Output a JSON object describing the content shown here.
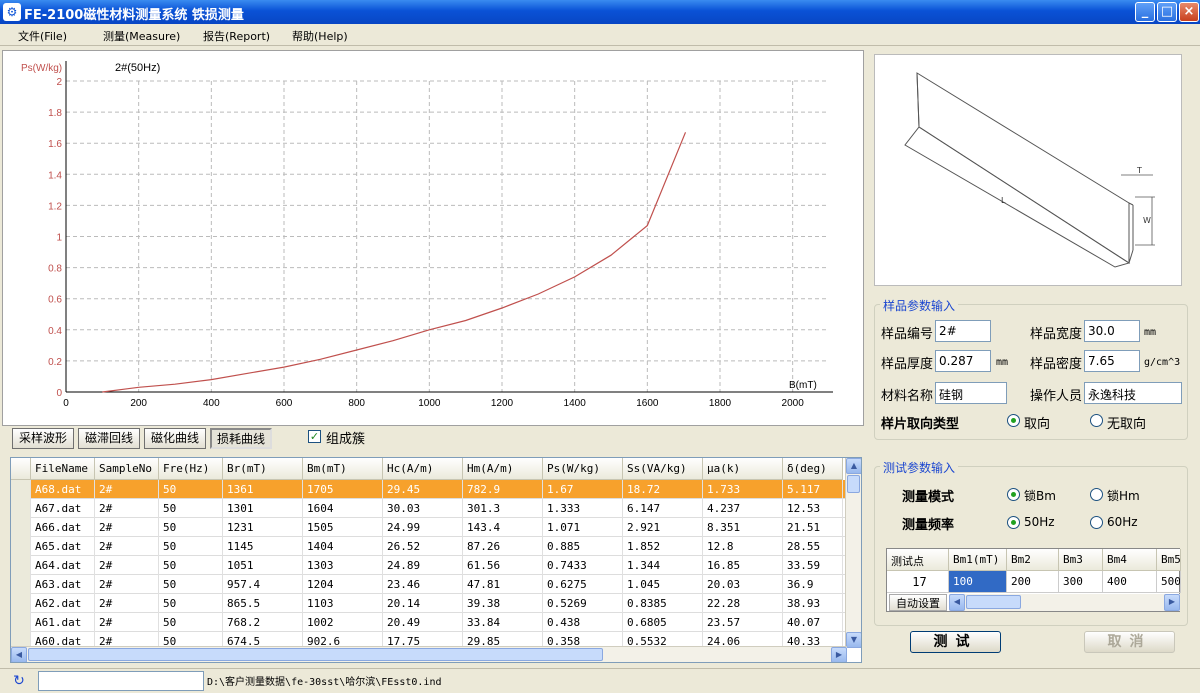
{
  "window": {
    "title": "FE-2100磁性材料测量系统  铁损测量",
    "min": "_",
    "max": "□",
    "close": "×"
  },
  "menu": [
    "文件(File)",
    "测量(Measure)",
    "报告(Report)",
    "帮助(Help)"
  ],
  "chart_data": {
    "type": "line",
    "title": "2#(50Hz)",
    "ylabel": "Ps(W/kg)",
    "xlabel": "B(mT)",
    "xlim": [
      0,
      2100
    ],
    "ylim": [
      0,
      2
    ],
    "xticks": [
      0,
      200,
      400,
      600,
      800,
      1000,
      1200,
      1400,
      1600,
      1800,
      2000
    ],
    "yticks": [
      0,
      0.2,
      0.4,
      0.6,
      0.8,
      1,
      1.2,
      1.4,
      1.6,
      1.8,
      2
    ],
    "grid": true,
    "line_color": "#c0504d",
    "x": [
      100,
      200,
      300,
      400,
      500,
      600,
      700,
      800,
      900,
      1000,
      1100,
      1200,
      1300,
      1400,
      1500,
      1600,
      1705
    ],
    "y": [
      0.0,
      0.03,
      0.05,
      0.08,
      0.12,
      0.16,
      0.21,
      0.27,
      0.33,
      0.4,
      0.46,
      0.54,
      0.63,
      0.74,
      0.88,
      1.07,
      1.67
    ]
  },
  "tabs": [
    "采样波形",
    "磁滞回线",
    "磁化曲线",
    "损耗曲线"
  ],
  "group_checkbox": {
    "label": "组成簇",
    "check": "✓"
  },
  "table": {
    "columns": [
      "FileName",
      "SampleNo",
      "Fre(Hz)",
      "Br(mT)",
      "Bm(mT)",
      "Hc(A/m)",
      "Hm(A/m)",
      "Ps(W/kg)",
      "Ss(VA/kg)",
      "μa(k)",
      "δ(deg)"
    ],
    "rows": [
      [
        "A68.dat",
        "2#",
        "50",
        "1361",
        "1705",
        "29.45",
        "782.9",
        "1.67",
        "18.72",
        "1.733",
        "5.117"
      ],
      [
        "A67.dat",
        "2#",
        "50",
        "1301",
        "1604",
        "30.03",
        "301.3",
        "1.333",
        "6.147",
        "4.237",
        "12.53"
      ],
      [
        "A66.dat",
        "2#",
        "50",
        "1231",
        "1505",
        "24.99",
        "143.4",
        "1.071",
        "2.921",
        "8.351",
        "21.51"
      ],
      [
        "A65.dat",
        "2#",
        "50",
        "1145",
        "1404",
        "26.52",
        "87.26",
        "0.885",
        "1.852",
        "12.8",
        "28.55"
      ],
      [
        "A64.dat",
        "2#",
        "50",
        "1051",
        "1303",
        "24.89",
        "61.56",
        "0.7433",
        "1.344",
        "16.85",
        "33.59"
      ],
      [
        "A63.dat",
        "2#",
        "50",
        "957.4",
        "1204",
        "23.46",
        "47.81",
        "0.6275",
        "1.045",
        "20.03",
        "36.9"
      ],
      [
        "A62.dat",
        "2#",
        "50",
        "865.5",
        "1103",
        "20.14",
        "39.38",
        "0.5269",
        "0.8385",
        "22.28",
        "38.93"
      ],
      [
        "A61.dat",
        "2#",
        "50",
        "768.2",
        "1002",
        "20.49",
        "33.84",
        "0.438",
        "0.6805",
        "23.57",
        "40.07"
      ],
      [
        "A60.dat",
        "2#",
        "50",
        "674.5",
        "902.6",
        "17.75",
        "29.85",
        "0.358",
        "0.5532",
        "24.06",
        "40.33"
      ]
    ]
  },
  "sample_group": {
    "title": "样品参数输入",
    "fields": [
      {
        "label": "样品编号",
        "value": "2#",
        "unit": ""
      },
      {
        "label": "样品宽度",
        "value": "30.0",
        "unit": "mm"
      },
      {
        "label": "样品厚度",
        "value": "0.287",
        "unit": "mm"
      },
      {
        "label": "样品密度",
        "value": "7.65",
        "unit": "g/cm^3"
      },
      {
        "label": "材料名称",
        "value": "硅钢",
        "unit": ""
      },
      {
        "label": "操作人员",
        "value": "永逸科技",
        "unit": ""
      }
    ],
    "orientation_label": "样片取向类型",
    "orientation_options": [
      "取向",
      "无取向"
    ]
  },
  "test_group": {
    "title": "测试参数输入",
    "mode_label": "测量模式",
    "mode_options": [
      "锁Bm",
      "锁Hm"
    ],
    "freq_label": "测量频率",
    "freq_options": [
      "50Hz",
      "60Hz"
    ],
    "grid_header": [
      "测试点",
      "Bm1(mT)",
      "Bm2",
      "Bm3",
      "Bm4",
      "Bm5"
    ],
    "points": "17",
    "bm_values": [
      "100",
      "200",
      "300",
      "400",
      "500"
    ],
    "auto_label": "自动设置"
  },
  "buttons": {
    "test": "测试",
    "cancel": "取消"
  },
  "preview_labels": {
    "t": "T",
    "w": "W",
    "l": "L"
  },
  "status": {
    "path": "D:\\客户测量数据\\fe-30sst\\哈尔滨\\FEsst0.ind",
    "input": ""
  }
}
